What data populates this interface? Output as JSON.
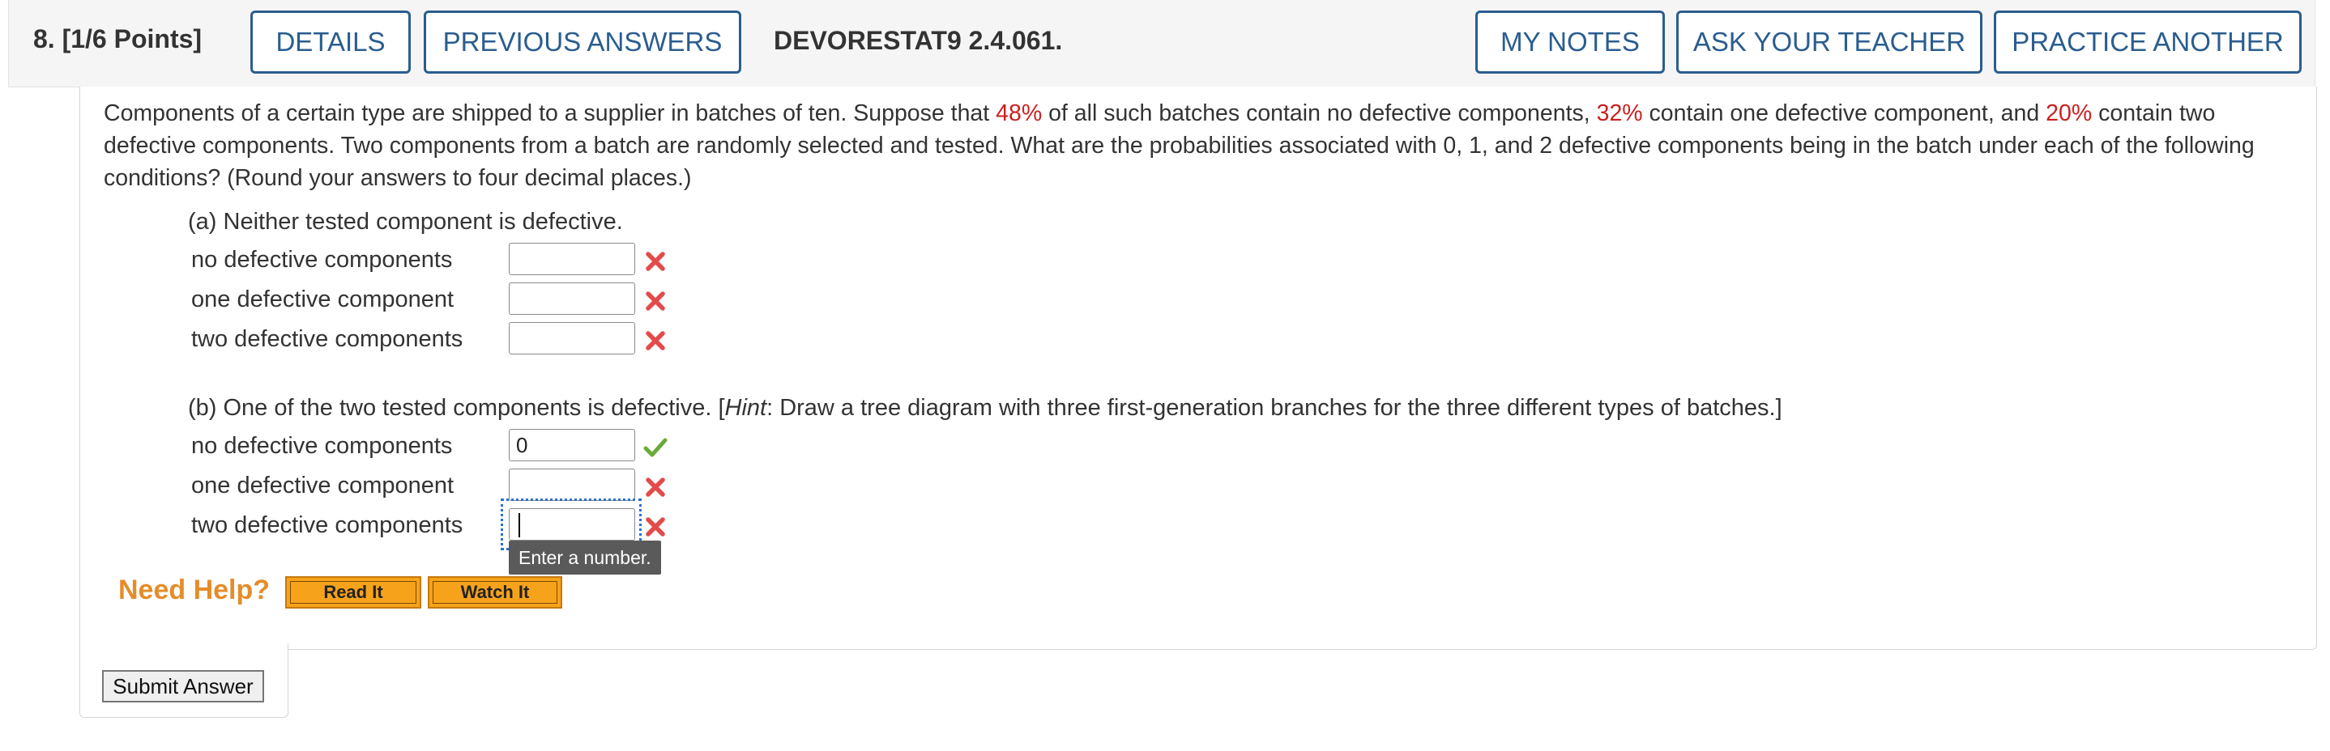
{
  "header": {
    "question_number": "8.",
    "points": "[1/6 Points]",
    "details_label": "DETAILS",
    "previous_answers_label": "PREVIOUS ANSWERS",
    "problem_code": "DEVORESTAT9 2.4.061.",
    "my_notes_label": "MY NOTES",
    "ask_teacher_label": "ASK YOUR TEACHER",
    "practice_another_label": "PRACTICE ANOTHER"
  },
  "problem": {
    "seg1": "Components of a certain type are shipped to a supplier in batches of ten. Suppose that ",
    "pct1": "48%",
    "seg2": " of all such batches contain no defective components, ",
    "pct2": "32%",
    "seg3": " contain one defective component, and ",
    "pct3": "20%",
    "seg4": " contain two defective components. Two components from a batch are randomly selected and tested. What are the probabilities associated with 0, 1, and 2 defective components being in the batch under each of the following conditions? (Round your answers to four decimal places.)"
  },
  "part_a": {
    "label": "(a) Neither tested component is defective.",
    "rows": [
      {
        "label": "no defective components",
        "value": "",
        "status": "incorrect"
      },
      {
        "label": "one defective component",
        "value": "",
        "status": "incorrect"
      },
      {
        "label": "two defective components",
        "value": "",
        "status": "incorrect"
      }
    ]
  },
  "part_b": {
    "label_pre": "(b) One of the two tested components is defective. [",
    "hint_word": "Hint",
    "label_post": ": Draw a tree diagram with three first-generation branches for the three different types of batches.]",
    "rows": [
      {
        "label": "no defective components",
        "value": "0",
        "status": "correct"
      },
      {
        "label": "one defective component",
        "value": "",
        "status": "incorrect"
      },
      {
        "label": "two defective components",
        "value": "",
        "status": "incorrect"
      }
    ],
    "tooltip": "Enter a number."
  },
  "help": {
    "need_help": "Need Help?",
    "read_it": "Read It",
    "watch_it": "Watch It"
  },
  "submit_label": "Submit Answer",
  "colors": {
    "accent_blue": "#2a5d8f",
    "highlight_red": "#cc1f1f",
    "incorrect_red": "#e34b4b",
    "correct_green": "#6aaa3a",
    "help_orange": "#e58c2a"
  }
}
